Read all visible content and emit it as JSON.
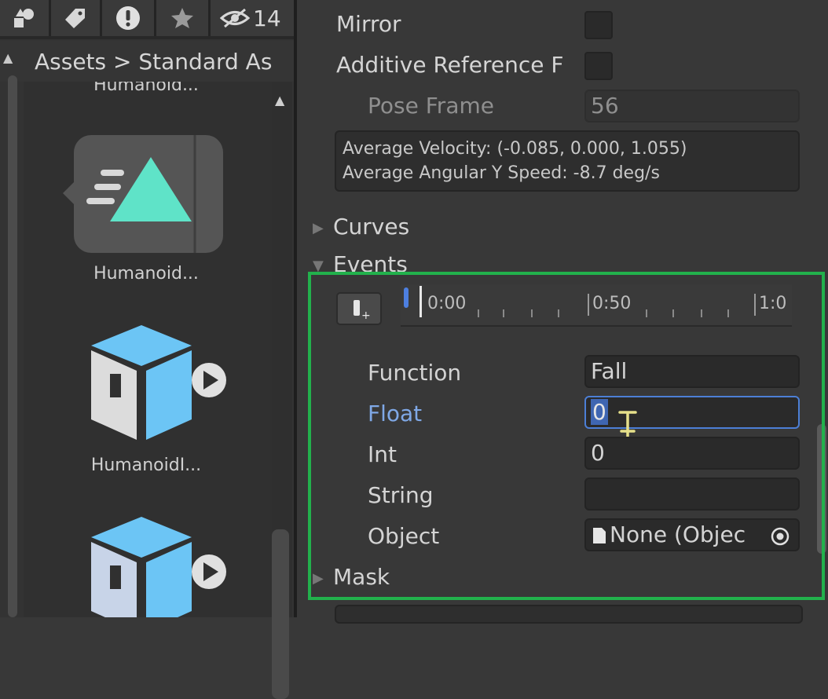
{
  "toolbar": {
    "buttons": [
      {
        "icon": "shapes-icon",
        "label": ""
      },
      {
        "icon": "tag-icon",
        "label": ""
      },
      {
        "icon": "warning-icon",
        "label": ""
      },
      {
        "icon": "star-icon",
        "label": ""
      },
      {
        "icon": "hidden-eye-icon",
        "label": "14"
      }
    ]
  },
  "breadcrumb": {
    "text": "Assets > Standard As"
  },
  "assets": {
    "top_cut_label": "Humanoid...",
    "items": [
      {
        "icon": "animation-clip-icon",
        "label": "Humanoid..."
      },
      {
        "icon": "prefab-model-icon",
        "label": "HumanoidI..."
      },
      {
        "icon": "prefab-model-icon",
        "label": ""
      }
    ]
  },
  "inspector": {
    "mirror_label": "Mirror",
    "additive_label": "Additive Reference F",
    "pose_frame_label": "Pose Frame",
    "pose_frame_value": "56",
    "info_line1": "Average Velocity: (-0.085, 0.000, 1.055)",
    "info_line2": "Average Angular Y Speed: -8.7 deg/s",
    "curves_label": "Curves",
    "events_label": "Events",
    "timeline_ticks": [
      "0:00",
      "0:50",
      "1:0"
    ],
    "function_label": "Function",
    "function_value": "Fall",
    "float_label": "Float",
    "float_value": "0",
    "int_label": "Int",
    "int_value": "0",
    "string_label": "String",
    "string_value": "",
    "object_label": "Object",
    "object_value": "None (Objec",
    "mask_label": "Mask"
  },
  "colors": {
    "highlight_box": "#22b14c",
    "focus_label": "#7fa8e6",
    "teal": "#5fe3c8",
    "blue_box": "#6cc5f5"
  }
}
